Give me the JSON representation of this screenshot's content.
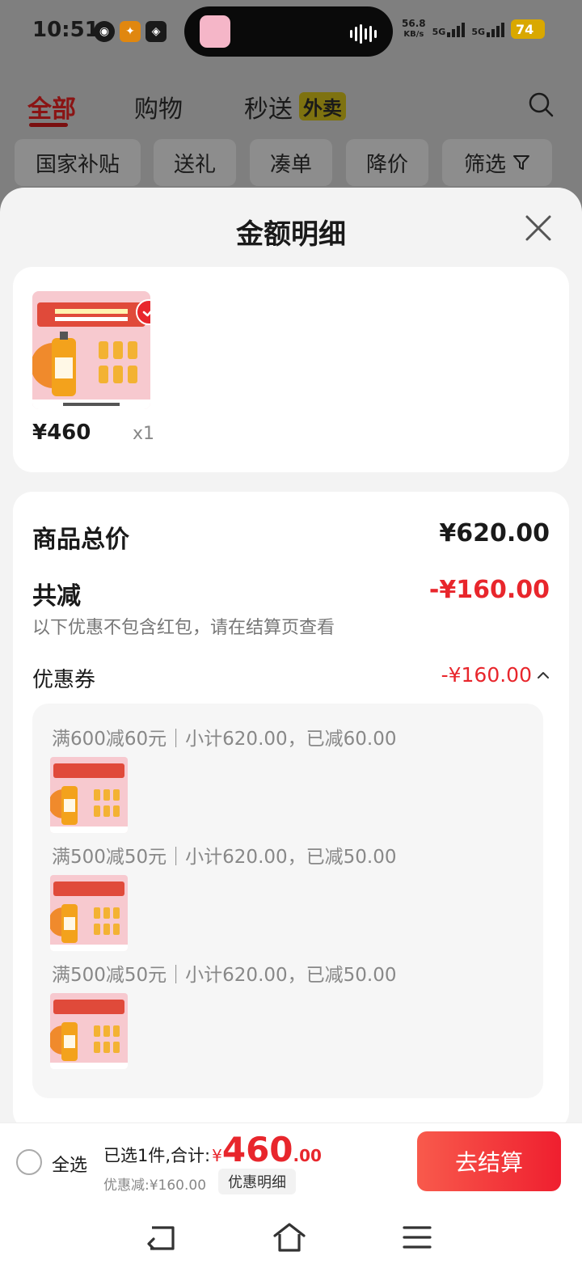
{
  "status_bar": {
    "time": "10:51",
    "net_speed_value": "56.8",
    "net_speed_unit": "KB/s",
    "signal_1": "5G",
    "signal_2": "5G",
    "battery": "74"
  },
  "tabs": [
    {
      "label": "全部",
      "active": true
    },
    {
      "label": "购物",
      "active": false
    },
    {
      "label": "秒送",
      "badge": "外卖",
      "active": false
    }
  ],
  "filters": [
    "国家补贴",
    "送礼",
    "凑单",
    "降价",
    "筛选"
  ],
  "sheet": {
    "title": "金额明细",
    "product": {
      "price": "¥460",
      "quantity": "x1"
    },
    "total_label": "商品总价",
    "total_value": "¥620.00",
    "reduction_label": "共减",
    "reduction_value": "-¥160.00",
    "reduction_note": "以下优惠不包含红包，请在结算页查看",
    "coupon_label": "优惠券",
    "coupon_value": "-¥160.00",
    "coupon_items": [
      {
        "text": "满600减60元｜小计620.00，已减60.00"
      },
      {
        "text": "满500减50元｜小计620.00，已减50.00"
      },
      {
        "text": "满500减50元｜小计620.00，已减50.00"
      }
    ]
  },
  "checkout": {
    "select_all": "全选",
    "summary_prefix": "已选1件,合计:",
    "currency": "¥",
    "total_int": "460",
    "total_dec": ".00",
    "discount_text": "优惠减:¥160.00",
    "detail_link": "优惠明细",
    "button": "去结算"
  },
  "colors": {
    "accent_red": "#e8262c",
    "sheet_bg": "#f3f3f3",
    "overlay": "#7f7f7f"
  }
}
